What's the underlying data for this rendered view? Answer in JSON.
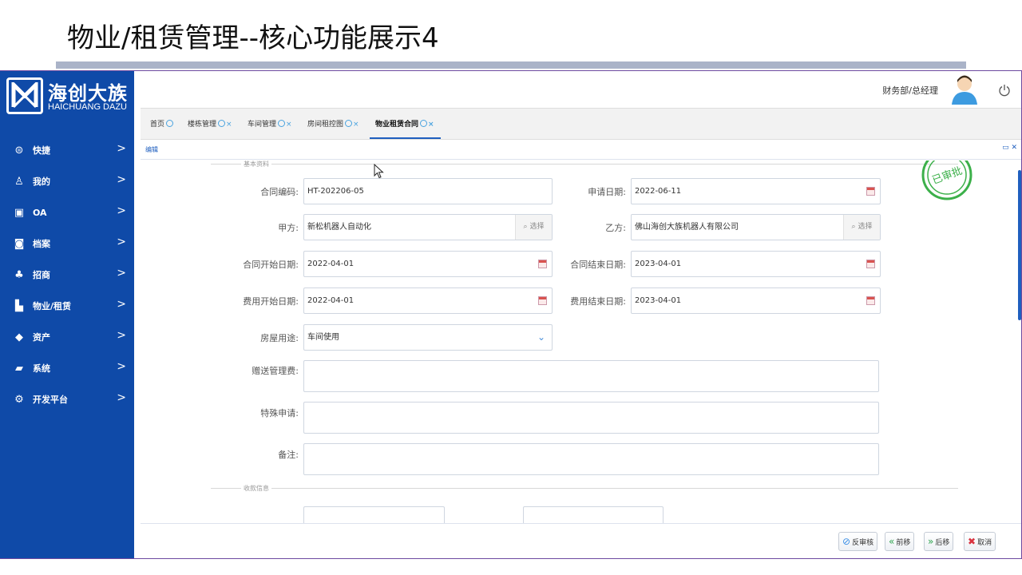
{
  "slide": {
    "title": "物业/租赁管理--核心功能展示4"
  },
  "logo": {
    "cn": "海创大族",
    "en": "HAICHUANG DAZU"
  },
  "sidebar": {
    "items": [
      {
        "label": "快捷",
        "icon": "circle-menu-icon"
      },
      {
        "label": "我的",
        "icon": "user-icon"
      },
      {
        "label": "OA",
        "icon": "oa-icon"
      },
      {
        "label": "档案",
        "icon": "archive-icon"
      },
      {
        "label": "招商",
        "icon": "investment-icon"
      },
      {
        "label": "物业/租赁",
        "icon": "property-icon"
      },
      {
        "label": "资产",
        "icon": "asset-icon"
      },
      {
        "label": "系统",
        "icon": "system-icon"
      },
      {
        "label": "开发平台",
        "icon": "gear-icon"
      }
    ]
  },
  "header": {
    "user_role": "财务部/总经理"
  },
  "tabs": [
    {
      "label": "首页"
    },
    {
      "label": "楼栋管理"
    },
    {
      "label": "车间管理"
    },
    {
      "label": "房间租控图"
    },
    {
      "label": "物业租赁合同"
    }
  ],
  "panel": {
    "title": "编辑",
    "controls": "▭ ✕"
  },
  "form": {
    "section_basic": "基本资料",
    "section_payment": "收款信息",
    "stamp_text": "已审批",
    "contract_no": {
      "label": "合同编码:",
      "value": "HT-202206-05"
    },
    "apply_date": {
      "label": "申请日期:",
      "value": "2022-06-11"
    },
    "party_a": {
      "label": "甲方:",
      "value": "新松机器人自动化",
      "pick": "选择"
    },
    "party_b": {
      "label": "乙方:",
      "value": "佛山海创大族机器人有限公司",
      "pick": "选择"
    },
    "contract_start": {
      "label": "合同开始日期:",
      "value": "2022-04-01"
    },
    "contract_end": {
      "label": "合同结束日期:",
      "value": "2023-04-01"
    },
    "fee_start": {
      "label": "费用开始日期:",
      "value": "2022-04-01"
    },
    "fee_end": {
      "label": "费用结束日期:",
      "value": "2023-04-01"
    },
    "usage": {
      "label": "房屋用途:",
      "value": "车间使用"
    },
    "gift_fee": {
      "label": "赠送管理费:",
      "value": ""
    },
    "special": {
      "label": "特殊申请:",
      "value": ""
    },
    "remark": {
      "label": "备注:",
      "value": ""
    }
  },
  "footer": {
    "buttons": [
      {
        "label": "反审核",
        "icon": "check-circle-icon"
      },
      {
        "label": "前移",
        "icon": "double-left-icon"
      },
      {
        "label": "后移",
        "icon": "double-right-icon"
      },
      {
        "label": "取消",
        "icon": "cancel-icon"
      }
    ]
  },
  "colors": {
    "sidebar": "#0f4aa8",
    "accent": "#1f5fbf",
    "stamp": "#3cb04a",
    "title_bar": "#aab3c8"
  }
}
